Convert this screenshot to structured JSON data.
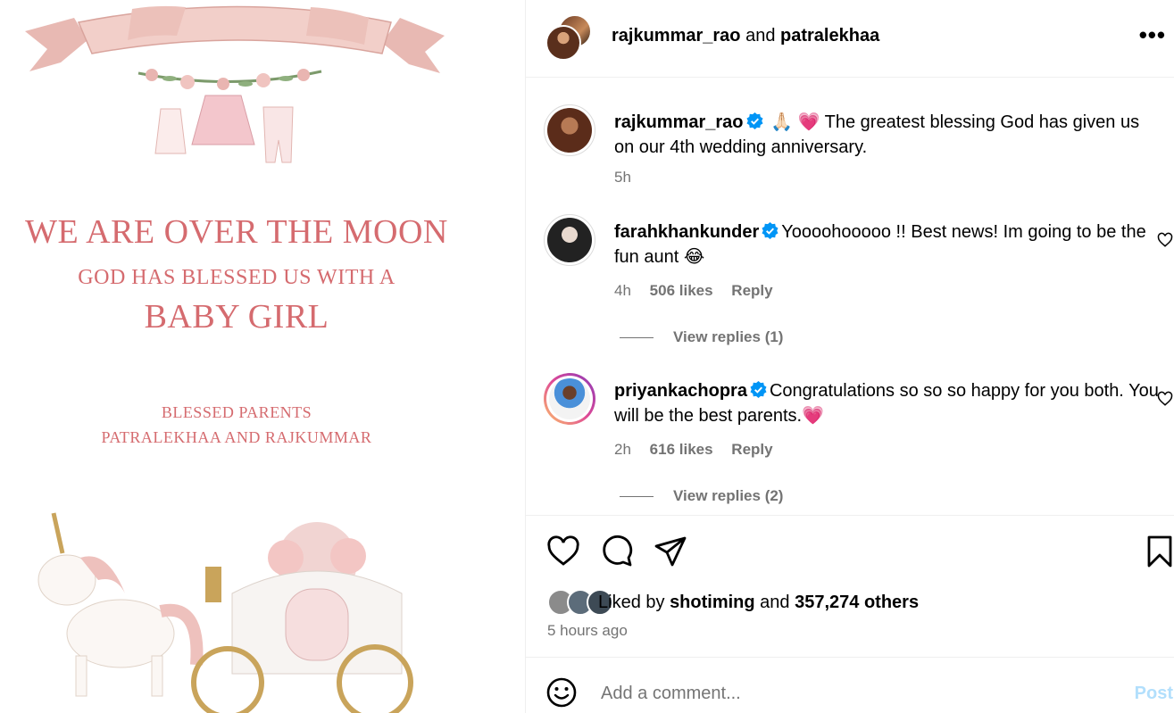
{
  "image": {
    "line1": "WE ARE OVER THE MOON",
    "line2": "GOD HAS BLESSED US WITH A",
    "line3": "BABY GIRL",
    "line4": "BLESSED PARENTS",
    "line5": "PATRALEKHAA AND RAJKUMMAR"
  },
  "header": {
    "user1": "rajkummar_rao",
    "joiner": " and ",
    "user2": "patralekhaa",
    "more": "•••"
  },
  "caption": {
    "user": "rajkummar_rao",
    "text": " 🙏🏻 💗 The greatest blessing God has given us on our 4th wedding anniversary.",
    "time": "5h"
  },
  "comments": [
    {
      "user": "farahkhankunder",
      "text": "Yoooohooooo !! Best news! Im going to be the fun aunt 😂",
      "time": "4h",
      "likes": "506 likes",
      "reply": "Reply",
      "view_replies": "View replies (1)"
    },
    {
      "user": "priyankachopra",
      "text": "Congratulations so so so happy for you both. You will be the best parents.💗",
      "time": "2h",
      "likes": "616 likes",
      "reply": "Reply",
      "view_replies": "View replies (2)"
    }
  ],
  "likes": {
    "prefix": "Liked by ",
    "user": "shotiming",
    "mid": " and ",
    "count": "357,274 others"
  },
  "time_ago": "5 hours ago",
  "add_comment": {
    "placeholder": "Add a comment...",
    "post": "Post"
  },
  "colors": {
    "accent_pink": "#d56b6f",
    "verified_blue": "#0095f6",
    "muted": "#737373",
    "post_disabled": "#b2dffc"
  },
  "icons": [
    "like-icon",
    "comment-icon",
    "share-icon",
    "save-icon",
    "emoji-icon",
    "verified-icon",
    "more-icon"
  ]
}
